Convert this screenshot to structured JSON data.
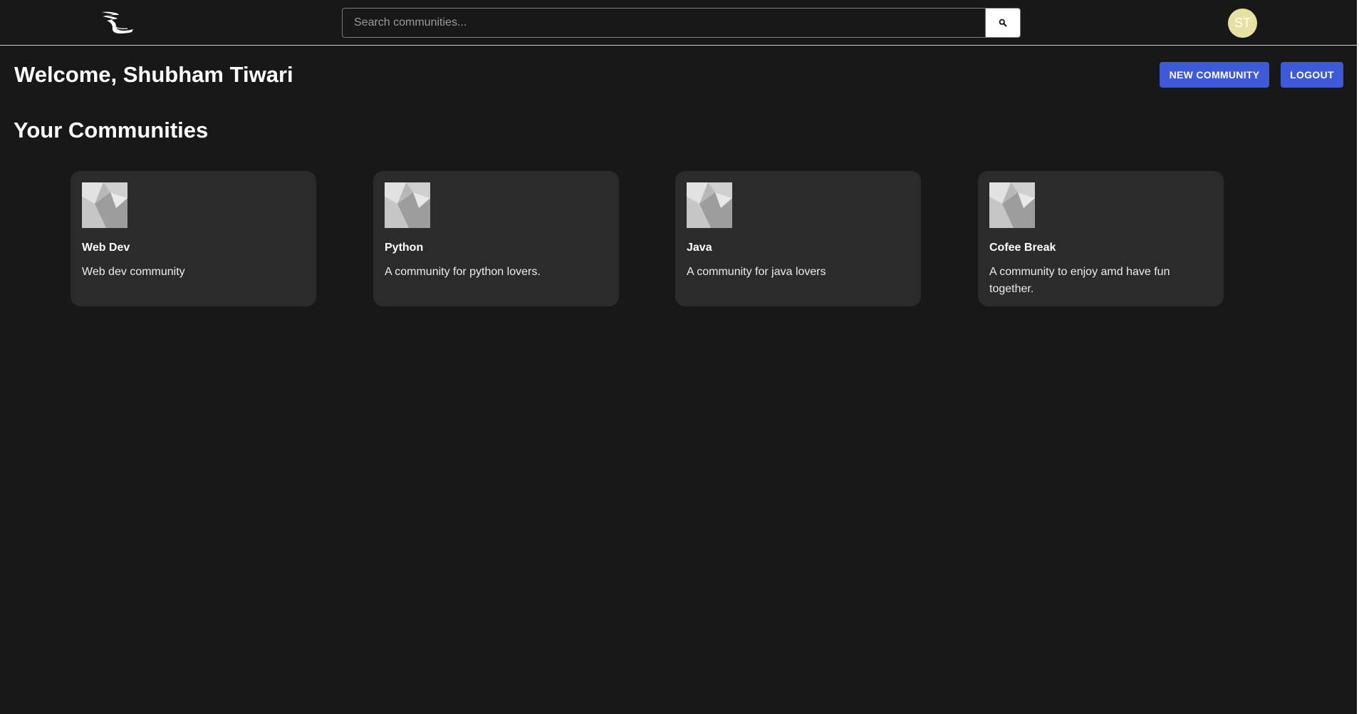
{
  "header": {
    "logo_icon": "bird-swoosh-logo-icon",
    "search": {
      "placeholder": "Search communities...",
      "value": "",
      "button_icon": "search-icon"
    },
    "avatar": {
      "initials": "ST",
      "color": "#e6e0a3"
    }
  },
  "welcome": {
    "title": "Welcome, Shubham Tiwari",
    "new_community_label": "NEW COMMUNITY",
    "logout_label": "LOGOUT",
    "button_color": "#3e5ad8"
  },
  "communities": {
    "title": "Your Communities",
    "cards": [
      {
        "name": "Web Dev",
        "description": "Web dev community",
        "image_icon": "community-thumbnail-icon"
      },
      {
        "name": "Python",
        "description": "A community for python lovers.",
        "image_icon": "community-thumbnail-icon"
      },
      {
        "name": "Java",
        "description": "A community for java lovers",
        "image_icon": "community-thumbnail-icon"
      },
      {
        "name": "Cofee Break",
        "description": "A community to enjoy amd have fun together.",
        "image_icon": "community-thumbnail-icon"
      }
    ]
  },
  "theme": {
    "background": "#181818",
    "card_background": "#2b2b2b"
  }
}
